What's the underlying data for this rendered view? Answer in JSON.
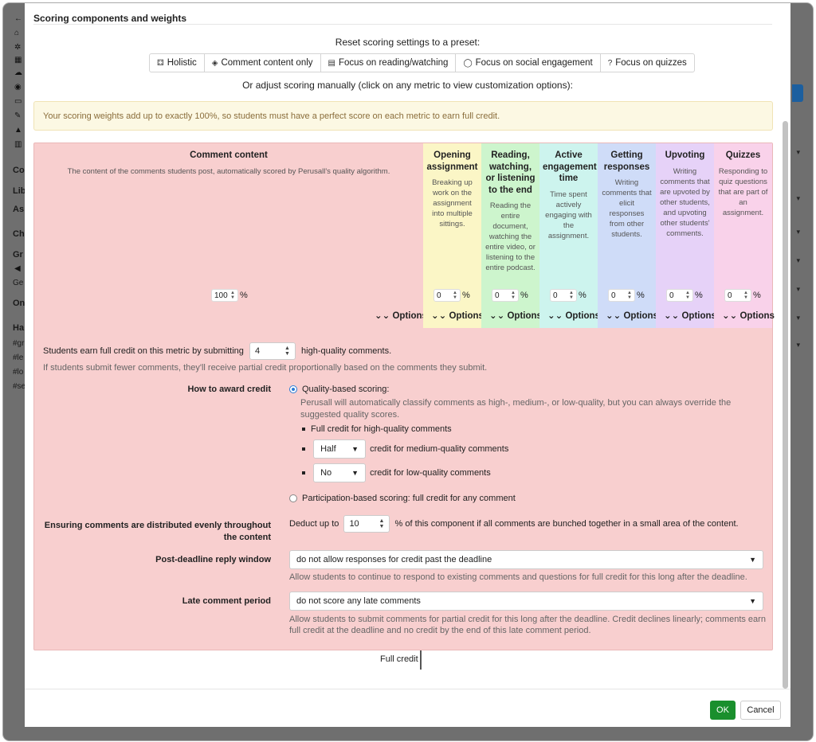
{
  "background": {
    "sidebar_fragments": [
      "Co",
      "Lib",
      "As",
      "Ch",
      "Gr",
      "Ge",
      "On",
      "Ha",
      "#gr",
      "#le",
      "#lo",
      "#se"
    ]
  },
  "modal": {
    "section_title": "Scoring components and weights",
    "preset_label": "Reset scoring settings to a preset:",
    "presets": [
      {
        "label": "Holistic",
        "icon": "cubes-icon",
        "glyph": "⚃"
      },
      {
        "label": "Comment content only",
        "icon": "cube-icon",
        "glyph": "◈"
      },
      {
        "label": "Focus on reading/watching",
        "icon": "book-icon",
        "glyph": "▤"
      },
      {
        "label": "Focus on social engagement",
        "icon": "comment-icon",
        "glyph": "◯"
      },
      {
        "label": "Focus on quizzes",
        "icon": "question-icon",
        "glyph": "?"
      }
    ],
    "manual_label": "Or adjust scoring manually (click on any metric to view customization options):",
    "alert": "Your scoring weights add up to exactly 100%, so students must have a perfect score on each metric to earn full credit.",
    "metrics": [
      {
        "title": "Comment content",
        "description": "The content of the comments students post, automatically scored by Perusall's quality algorithm.",
        "value": "100",
        "color": "#f8cfcf"
      },
      {
        "title": "Opening assignment",
        "description": "Breaking up work on the assignment into multiple sittings.",
        "value": "0",
        "color": "#fbf6c6"
      },
      {
        "title": "Reading, watching, or listening to the end",
        "description": "Reading the entire document, watching the entire video, or listening to the entire podcast.",
        "value": "0",
        "color": "#cdf5cd"
      },
      {
        "title": "Active engagement time",
        "description": "Time spent actively engaging with the assignment.",
        "value": "0",
        "color": "#cdf4ee"
      },
      {
        "title": "Getting responses",
        "description": "Writing comments that elicit responses from other students.",
        "value": "0",
        "color": "#cfdcf8"
      },
      {
        "title": "Upvoting",
        "description": "Writing comments that are upvoted by other students, and upvoting other students' comments.",
        "value": "0",
        "color": "#e6d2f8"
      },
      {
        "title": "Quizzes",
        "description": "Responding to quiz questions that are part of an assignment.",
        "value": "0",
        "color": "#f9d2ea"
      }
    ],
    "percent_sign": "%",
    "options_label": "Options",
    "detail": {
      "earn_prefix": "Students earn full credit on this metric by submitting",
      "earn_value": "4",
      "earn_suffix": "high-quality comments.",
      "partial_note": "If students submit fewer comments, they'll receive partial credit proportionally based on the comments they submit.",
      "award_label": "How to award credit",
      "quality_option": "Quality-based scoring:",
      "quality_desc": "Perusall will automatically classify comments as high-, medium-, or low-quality, but you can always override the suggested quality scores.",
      "high_credit": "Full credit for high-quality comments",
      "medium_value": "Half",
      "medium_suffix": "credit for medium-quality comments",
      "low_value": "No",
      "low_suffix": "credit for low-quality comments",
      "participation_option": "Participation-based scoring: full credit for any comment",
      "distribute_label": "Ensuring comments are distributed evenly throughout the content",
      "deduct_prefix": "Deduct up to",
      "deduct_value": "10",
      "deduct_suffix": "% of this component if all comments are bunched together in a small area of the content.",
      "reply_label": "Post-deadline reply window",
      "reply_value": "do not allow responses for credit past the deadline",
      "reply_note": "Allow students to continue to respond to existing comments and questions for full credit for this long after the deadline.",
      "late_label": "Late comment period",
      "late_value": "do not score any late comments",
      "late_note": "Allow students to submit comments for partial credit for this long after the deadline. Credit declines linearly; comments earn full credit at the deadline and no credit by the end of this late comment period."
    },
    "full_credit_label": "Full credit",
    "ok_label": "OK",
    "cancel_label": "Cancel"
  }
}
